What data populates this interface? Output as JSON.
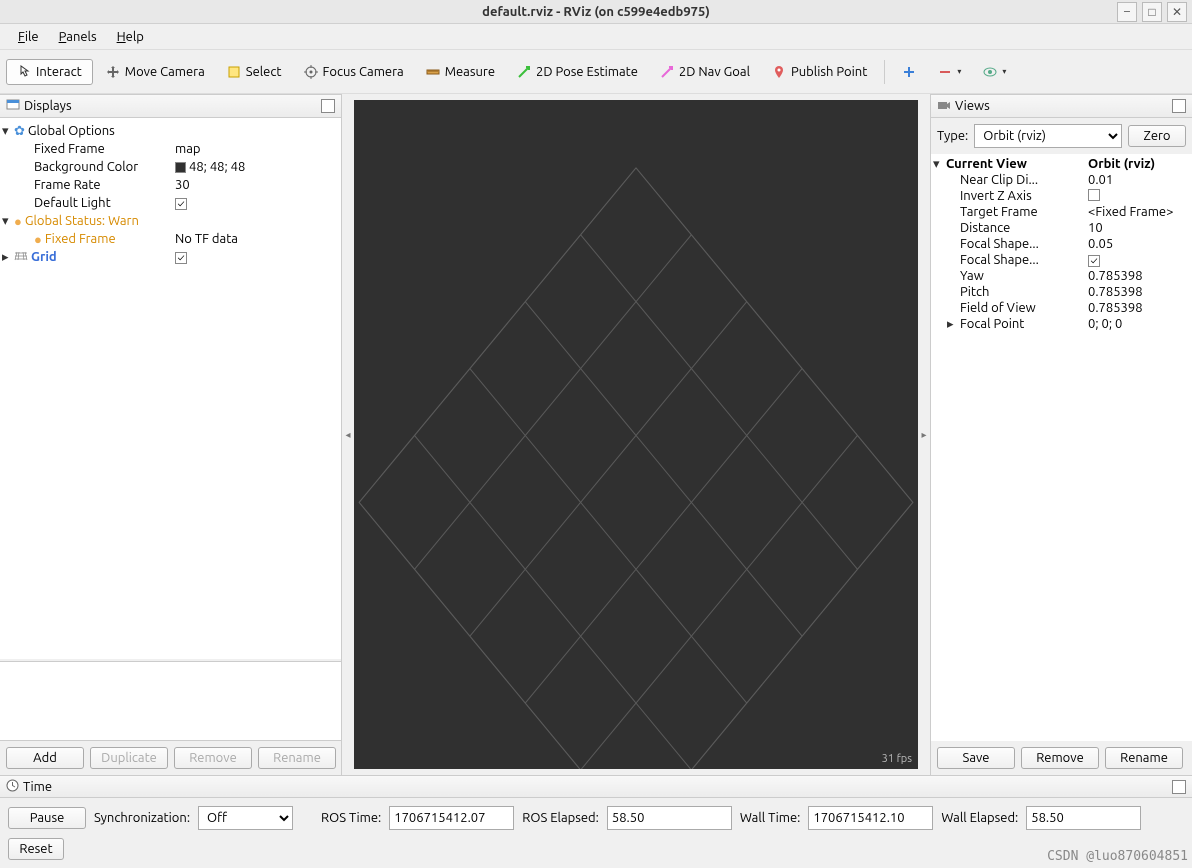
{
  "window": {
    "title": "default.rviz - RViz (on c599e4edb975)"
  },
  "menu": {
    "file": "File",
    "panels": "Panels",
    "help": "Help"
  },
  "toolbar": {
    "interact": "Interact",
    "move_camera": "Move Camera",
    "select": "Select",
    "focus_camera": "Focus Camera",
    "measure": "Measure",
    "pose_estimate": "2D Pose Estimate",
    "nav_goal": "2D Nav Goal",
    "publish_point": "Publish Point"
  },
  "displays": {
    "title": "Displays",
    "global_options": "Global Options",
    "fixed_frame_lbl": "Fixed Frame",
    "fixed_frame_val": "map",
    "bg_lbl": "Background Color",
    "bg_val": "48; 48; 48",
    "fr_lbl": "Frame Rate",
    "fr_val": "30",
    "dl_lbl": "Default Light",
    "status_warn": "Global Status: Warn",
    "ff_warn": "Fixed Frame",
    "ff_warn_val": "No TF data",
    "grid": "Grid",
    "btns": {
      "add": "Add",
      "dup": "Duplicate",
      "rem": "Remove",
      "ren": "Rename"
    }
  },
  "views": {
    "title": "Views",
    "type_lbl": "Type:",
    "type_val": "Orbit (rviz)",
    "zero": "Zero",
    "current_view": "Current View",
    "current_view_val": "Orbit (rviz)",
    "rows": [
      {
        "l": "Near Clip Di...",
        "v": "0.01"
      },
      {
        "l": "Invert Z Axis",
        "v": "_chk_off"
      },
      {
        "l": "Target Frame",
        "v": "<Fixed Frame>"
      },
      {
        "l": "Distance",
        "v": "10"
      },
      {
        "l": "Focal Shape...",
        "v": "0.05"
      },
      {
        "l": "Focal Shape...",
        "v": "_chk_on"
      },
      {
        "l": "Yaw",
        "v": "0.785398"
      },
      {
        "l": "Pitch",
        "v": "0.785398"
      },
      {
        "l": "Field of View",
        "v": "0.785398"
      },
      {
        "l": "Focal Point",
        "v": "0; 0; 0",
        "arrow": true
      }
    ],
    "btns": {
      "save": "Save",
      "rem": "Remove",
      "ren": "Rename"
    }
  },
  "time": {
    "title": "Time",
    "pause": "Pause",
    "sync_lbl": "Synchronization:",
    "sync_val": "Off",
    "ros_time_lbl": "ROS Time:",
    "ros_time_val": "1706715412.07",
    "ros_elapsed_lbl": "ROS Elapsed:",
    "ros_elapsed_val": "58.50",
    "wall_time_lbl": "Wall Time:",
    "wall_time_val": "1706715412.10",
    "wall_elapsed_lbl": "Wall Elapsed:",
    "wall_elapsed_val": "58.50",
    "reset": "Reset"
  },
  "viewport": {
    "fps": "31 fps"
  },
  "watermark": "CSDN @luo870604851"
}
